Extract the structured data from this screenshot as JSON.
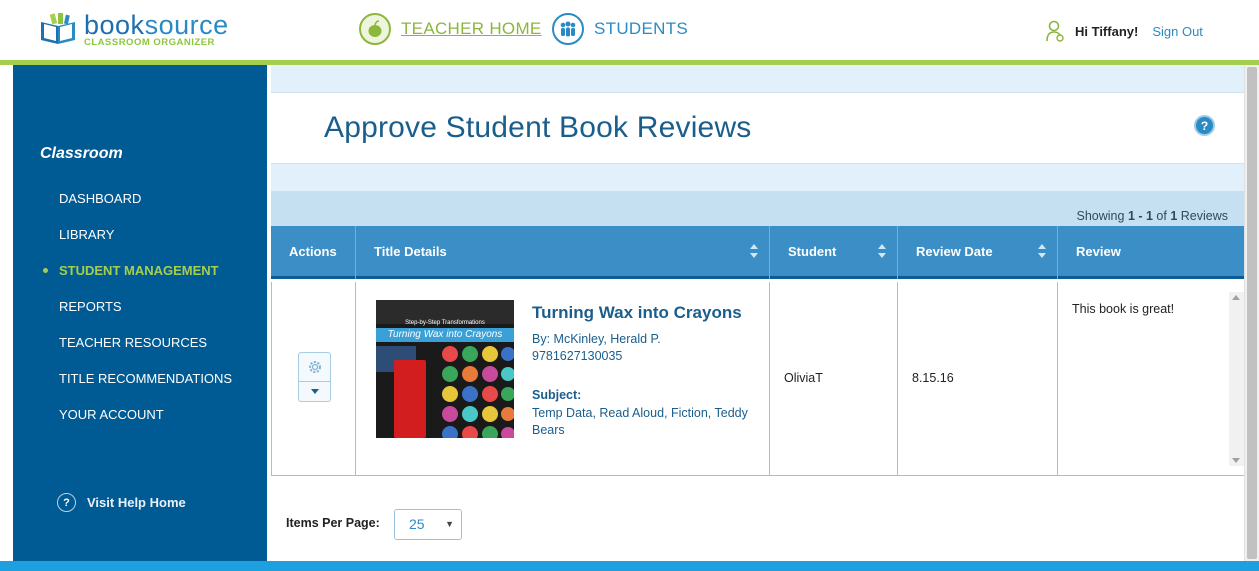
{
  "header": {
    "logo_word_part1": "book",
    "logo_word_part2": "source",
    "logo_sub": "CLASSROOM ORGANIZER",
    "nav_teacher_home": "TEACHER HOME",
    "nav_students": "STUDENTS",
    "greeting": "Hi Tiffany!",
    "sign_out": "Sign Out"
  },
  "sidebar": {
    "title": "Classroom",
    "items": [
      {
        "label": "DASHBOARD",
        "active": false
      },
      {
        "label": "LIBRARY",
        "active": false
      },
      {
        "label": "STUDENT MANAGEMENT",
        "active": true
      },
      {
        "label": "REPORTS",
        "active": false
      },
      {
        "label": "TEACHER RESOURCES",
        "active": false
      },
      {
        "label": "TITLE RECOMMENDATIONS",
        "active": false
      },
      {
        "label": "YOUR ACCOUNT",
        "active": false
      }
    ],
    "help_label": "Visit Help Home",
    "help_icon_glyph": "?"
  },
  "main": {
    "page_title": "Approve Student Book Reviews",
    "help_glyph": "?",
    "showing_prefix": "Showing ",
    "showing_range": "1 - 1",
    "showing_of": " of ",
    "showing_total": "1",
    "showing_suffix": " Reviews",
    "columns": {
      "actions": "Actions",
      "title": "Title Details",
      "student": "Student",
      "date": "Review Date",
      "review": "Review"
    },
    "row": {
      "cover_subtitle": "Step-by-Step Transformations",
      "cover_title": "Turning Wax into Crayons",
      "title": "Turning Wax into Crayons",
      "author": "By: McKinley, Herald P.",
      "isbn": "9781627130035",
      "subject_label": "Subject:",
      "subjects": "Temp Data, Read Aloud, Fiction, Teddy Bears",
      "student": "OliviaT",
      "review_date": "8.15.16",
      "review": "This book is great!"
    },
    "items_per_page_label": "Items Per Page:",
    "items_per_page_value": "25"
  },
  "colors": {
    "brand_blue": "#2a8bc4",
    "brand_green": "#a6ce4e",
    "sidebar_bg": "#005a94",
    "table_header": "#3c8ec6",
    "title_blue": "#1a5e8c"
  },
  "icons": [
    "logo-book-icon",
    "apple-icon",
    "students-icon",
    "user-icon",
    "help-icon",
    "gear-icon",
    "caret-down-icon",
    "sort-icon"
  ]
}
